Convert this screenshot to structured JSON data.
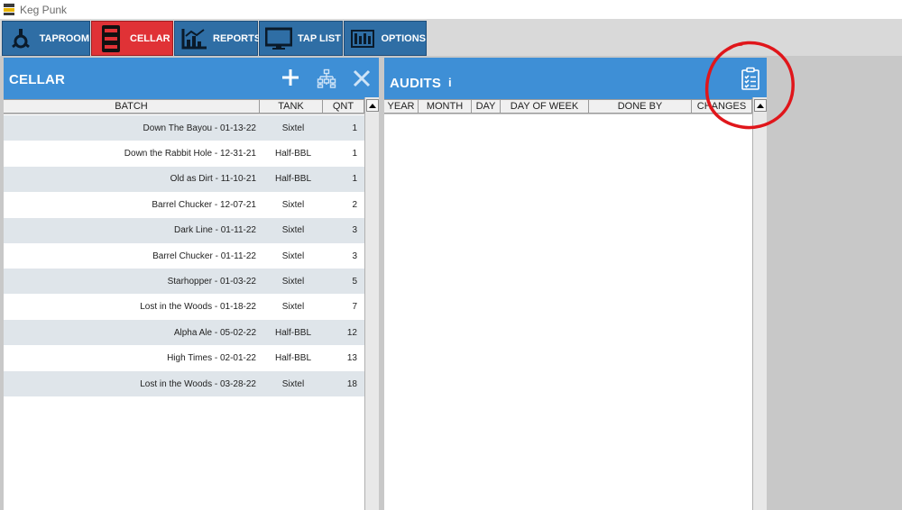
{
  "window": {
    "title": "Keg Punk"
  },
  "tabs": [
    {
      "label": "TAPROOM",
      "icon": "taproom-icon",
      "active": false
    },
    {
      "label": "CELLAR",
      "icon": "keg-icon",
      "active": true
    },
    {
      "label": "REPORTS",
      "icon": "chart-icon",
      "active": false
    },
    {
      "label": "TAP LIST",
      "icon": "monitor-icon",
      "active": false
    },
    {
      "label": "OPTIONS",
      "icon": "options-icon",
      "active": false
    }
  ],
  "cellar": {
    "title": "CELLAR",
    "buttons": [
      "add-icon",
      "hierarchy-icon",
      "close-icon"
    ],
    "columns": [
      "BATCH",
      "TANK",
      "QNT"
    ],
    "rows": [
      {
        "batch": "Down The Bayou - 01-13-22",
        "tank": "Sixtel",
        "qnt": "1"
      },
      {
        "batch": "Down the Rabbit Hole - 12-31-21",
        "tank": "Half-BBL",
        "qnt": "1"
      },
      {
        "batch": "Old as Dirt - 11-10-21",
        "tank": "Half-BBL",
        "qnt": "1"
      },
      {
        "batch": "Barrel Chucker - 12-07-21",
        "tank": "Sixtel",
        "qnt": "2"
      },
      {
        "batch": "Dark Line - 01-11-22",
        "tank": "Sixtel",
        "qnt": "3"
      },
      {
        "batch": "Barrel Chucker - 01-11-22",
        "tank": "Sixtel",
        "qnt": "3"
      },
      {
        "batch": "Starhopper - 01-03-22",
        "tank": "Sixtel",
        "qnt": "5"
      },
      {
        "batch": "Lost in the Woods - 01-18-22",
        "tank": "Sixtel",
        "qnt": "7"
      },
      {
        "batch": "Alpha Ale - 05-02-22",
        "tank": "Half-BBL",
        "qnt": "12"
      },
      {
        "batch": "High Times - 02-01-22",
        "tank": "Half-BBL",
        "qnt": "13"
      },
      {
        "batch": "Lost in the Woods - 03-28-22",
        "tank": "Sixtel",
        "qnt": "18"
      }
    ]
  },
  "audits": {
    "title": "AUDITS",
    "info_glyph": "i",
    "button": "clipboard-icon",
    "columns": [
      "YEAR",
      "MONTH",
      "DAY",
      "DAY OF WEEK",
      "DONE BY",
      "CHANGES"
    ],
    "rows": []
  },
  "colors": {
    "header_blue": "#3e8fd6",
    "tab_blue": "#2f6ea5",
    "tab_active_red": "#e03236",
    "row_alt": "#dfe5ea",
    "annotation_red": "#e0161b"
  }
}
